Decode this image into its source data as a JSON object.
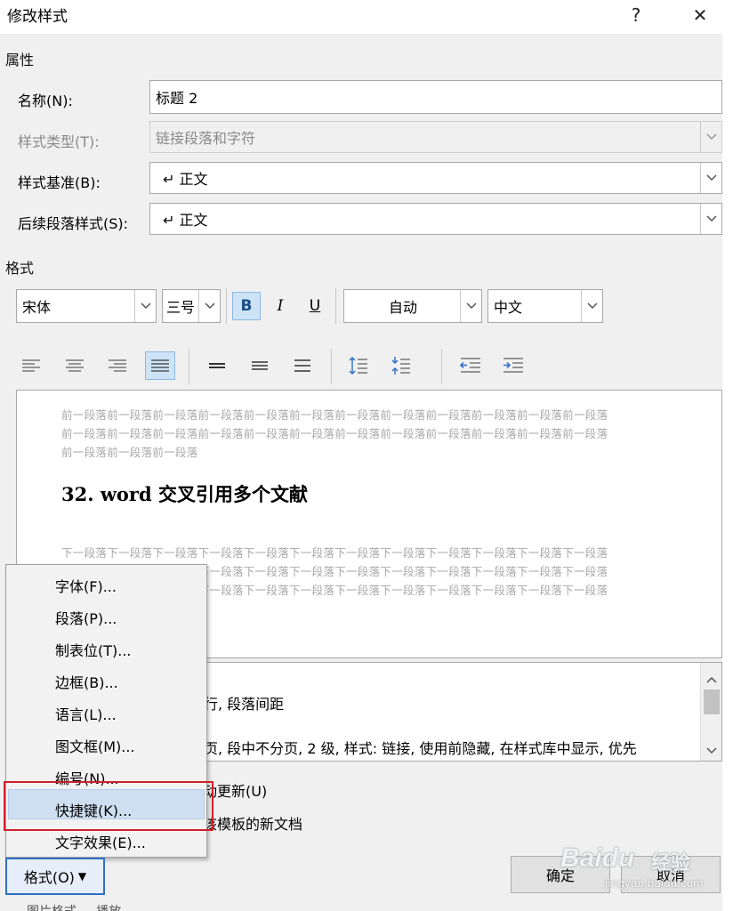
{
  "window": {
    "title": "修改样式",
    "help": "?",
    "close": "✕"
  },
  "properties": {
    "section_label": "属性",
    "name_label": "名称(N):",
    "name_value": "标题 2",
    "style_type_label": "样式类型(T):",
    "style_type_value": "链接段落和字符",
    "style_based_label": "样式基准(B):",
    "style_based_value": "↵ 正文",
    "next_style_label": "后续段落样式(S):",
    "next_style_value": "↵ 正文"
  },
  "format": {
    "section_label": "格式",
    "font": "宋体",
    "size": "三号",
    "bold": "B",
    "italic": "I",
    "underline": "U",
    "color": "自动",
    "script": "中文"
  },
  "preview": {
    "prev_line1": "前一段落前一段落前一段落前一段落前一段落前一段落前一段落前一段落前一段落前一段落前一段落前一段落",
    "prev_line2": "前一段落前一段落前一段落前一段落前一段落前一段落前一段落前一段落前一段落前一段落前一段落前一段落",
    "prev_line3": "前一段落前一段落前一段落",
    "heading": "32. word 交叉引用多个文献",
    "next_line1": "下一段落下一段落下一段落下一段落下一段落下一段落下一段落下一段落下一段落下一段落下一段落下一段落",
    "next_line2": "下一段落下一段落下一段落下一段落下一段落下一段落下一段落下一段落下一段落下一段落下一段落下一段落",
    "next_line3": "下一段落下一段落下一段落下一段落下一段落下一段落下一段落下一段落下一段落下一段落下一段落下一段落"
  },
  "description": {
    "line1": "行, 段落间距",
    "line2": "页, 段中不分页, 2 级, 样式: 链接, 使用前隐藏, 在样式库中显示, 优先"
  },
  "options": {
    "auto_update": "动更新(U)",
    "new_docs": "该模板的新文档"
  },
  "menu": {
    "items": [
      "字体(F)...",
      "段落(P)...",
      "制表位(T)...",
      "边框(B)...",
      "语言(L)...",
      "图文框(M)...",
      "编号(N)...",
      "快捷键(K)...",
      "文字效果(E)..."
    ],
    "highlighted": "快捷键(K)..."
  },
  "buttons": {
    "format": "格式(O)",
    "ok": "确定",
    "cancel": "取消"
  },
  "watermark": {
    "brand": "Baidu",
    "brand_cn": "经验",
    "url": "jingyan.baidu.com"
  },
  "bottom_text": "图片格式 ... 播放 ..."
}
